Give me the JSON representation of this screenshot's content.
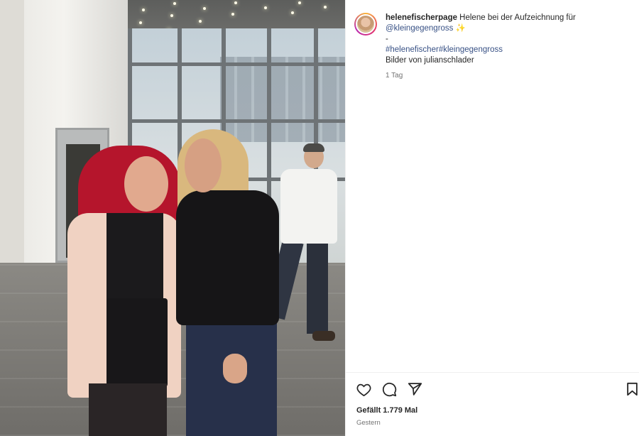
{
  "post": {
    "username": "helenefischerpage",
    "caption_text": " Helene bei der Aufzeichnung für",
    "mention": "@kleingegengross",
    "sparkle": " ✨",
    "dash": "-",
    "hashtag1": "#helenefischer",
    "hashtag2": "#kleingegengross",
    "credit": "Bilder von julianschlader",
    "caption_age": "1 Tag",
    "likes": "Gefällt 1.779 Mal",
    "date": "Gestern"
  },
  "icons": {
    "like": "heart-icon",
    "comment": "comment-icon",
    "share": "send-icon",
    "save": "bookmark-icon"
  },
  "colors": {
    "link": "#385185",
    "text": "#262626",
    "muted": "#737373"
  }
}
